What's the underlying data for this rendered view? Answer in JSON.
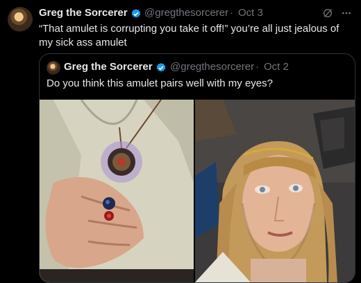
{
  "tweet": {
    "author_name": "Greg the Sorcerer",
    "handle": "@gregthesorcerer",
    "separator": "·",
    "date": "Oct 3",
    "text": "“That amulet is corrupting you take it off!” you’re all just jealous of my sick ass amulet",
    "icons": [
      "grok-icon",
      "more-icon"
    ]
  },
  "quoted_tweet": {
    "author_name": "Greg the Sorcerer",
    "handle": "@gregthesorcerer",
    "separator": "·",
    "date": "Oct 2",
    "text": "Do you think this amulet pairs well with my eyes?",
    "media": [
      "amulet-chest-photo",
      "face-selfie-photo"
    ]
  },
  "colors": {
    "background": "#000000",
    "text": "#e7e9ea",
    "secondary_text": "#71767b",
    "verified_blue": "#1d9bf0",
    "border": "#2f3336"
  }
}
